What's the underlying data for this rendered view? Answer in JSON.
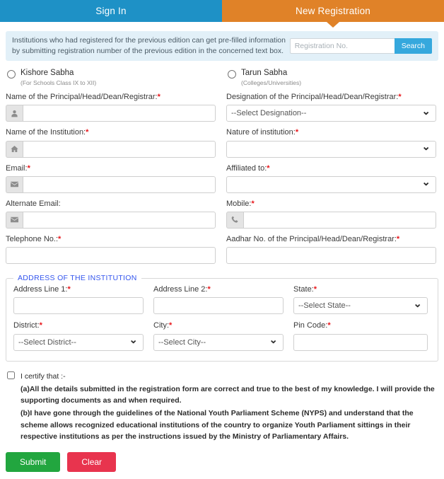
{
  "tabs": [
    {
      "label": "Sign In",
      "name": "tab-sign-in",
      "active": false
    },
    {
      "label": "New Registration",
      "name": "tab-new-registration",
      "active": true
    }
  ],
  "banner": {
    "text": "Institutions who had registered for the previous edition can get pre-filled information by submitting registration number of the previous edition in the concerned text box.",
    "search_placeholder": "Registration No.",
    "search_value": "",
    "search_button": "Search"
  },
  "sabha": {
    "kishore": {
      "label": "Kishore Sabha",
      "sub": "(For Schools Class IX to XII)",
      "selected": false
    },
    "tarun": {
      "label": "Tarun Sabha",
      "sub": "(Colleges/Universities)",
      "selected": false
    }
  },
  "fields": {
    "principal_name": {
      "label": "Name of the Principal/Head/Dean/Registrar:",
      "required": true,
      "value": "",
      "placeholder": "",
      "icon": "user-icon"
    },
    "designation": {
      "label": "Designation of the Principal/Head/Dean/Registrar:",
      "required": true,
      "value": "--Select Designation--"
    },
    "institution_name": {
      "label": "Name of the Institution:",
      "required": true,
      "value": "",
      "placeholder": "",
      "icon": "home-icon"
    },
    "nature": {
      "label": "Nature of institution:",
      "required": true,
      "value": ""
    },
    "email": {
      "label": "Email:",
      "required": true,
      "value": "",
      "placeholder": "",
      "icon": "envelope-icon"
    },
    "affiliated": {
      "label": "Affiliated to:",
      "required": true,
      "value": ""
    },
    "alternate_email": {
      "label": "Alternate Email:",
      "required": false,
      "value": "",
      "placeholder": "",
      "icon": "envelope-icon"
    },
    "mobile": {
      "label": "Mobile:",
      "required": true,
      "value": "",
      "placeholder": "",
      "icon": "phone-icon"
    },
    "telephone": {
      "label": "Telephone No.:",
      "required": true,
      "value": "",
      "placeholder": ""
    },
    "aadhar": {
      "label": "Aadhar No. of the Principal/Head/Dean/Registrar:",
      "required": true,
      "value": "",
      "placeholder": ""
    }
  },
  "address": {
    "legend": "ADDRESS OF THE INSTITUTION",
    "line1": {
      "label": "Address Line 1:",
      "required": true,
      "value": "",
      "placeholder": ""
    },
    "line2": {
      "label": "Address Line 2:",
      "required": true,
      "value": "",
      "placeholder": ""
    },
    "state": {
      "label": "State:",
      "required": true,
      "value": "--Select State--"
    },
    "district": {
      "label": "District:",
      "required": true,
      "value": "--Select District--"
    },
    "city": {
      "label": "City:",
      "required": true,
      "value": "--Select City--"
    },
    "pincode": {
      "label": "Pin Code:",
      "required": true,
      "value": "",
      "placeholder": ""
    }
  },
  "certify": {
    "checked": false,
    "heading": "I certify that :-",
    "point_a": "(a)All the details submitted in the registration form are correct and true to the best of my knowledge. I will provide the supporting documents as and when required.",
    "point_b": "(b)I have gone through the guidelines of the National Youth Parliament Scheme (NYPS) and understand that the scheme allows recognized educational institutions of the country to organize Youth Parliament sittings in their respective institutions as per the instructions issued by the Ministry of Parliamentary Affairs."
  },
  "actions": {
    "submit": "Submit",
    "clear": "Clear"
  },
  "colors": {
    "tab_active": "#e08228",
    "tab_inactive": "#1e91c6",
    "banner_bg": "#e2f0f8",
    "search_button": "#35a8dd",
    "legend": "#3355ee",
    "required": "#e8161b",
    "submit": "#22a63f",
    "clear": "#e8344e"
  }
}
